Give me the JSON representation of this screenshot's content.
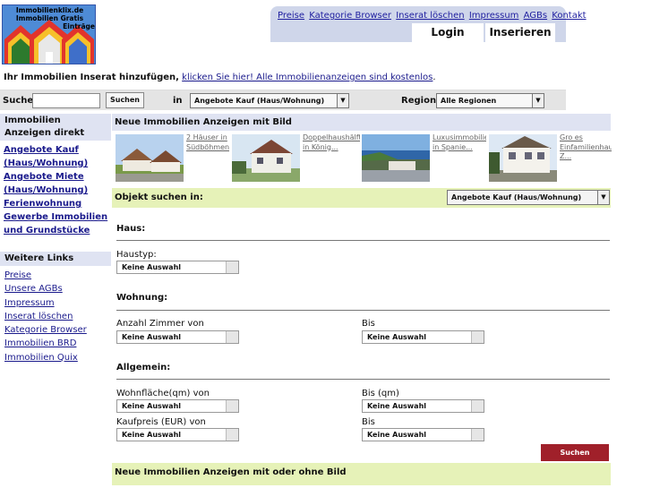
{
  "logo": {
    "line1": "Immobilienklix.de",
    "line2": "Immobilien Gratis",
    "line3": "Einträge"
  },
  "topnav": {
    "links": [
      "Preise",
      "Kategorie Browser",
      "Inserat löschen",
      "Impressum",
      "AGBs",
      "Kontakt"
    ],
    "login": "Login",
    "inserieren": "Inserieren"
  },
  "notice": {
    "bold": "Ihr Immobilien Inserat hinzufügen,",
    "link": "klicken Sie hier! Alle Immobilienanzeigen sind kostenlos",
    "end": "."
  },
  "searchbar": {
    "suche_label": "Suche",
    "search_value": "",
    "search_button": "Suchen",
    "in_label": "in",
    "category_value": "Angebote Kauf (Haus/Wohnung)",
    "region_label": "Region",
    "region_value": "Alle Regionen"
  },
  "sidebar": {
    "head1": "Immobilien Anzeigen direkt",
    "links1": [
      "Angebote Kauf (Haus/Wohnung)",
      "Angebote Miete (Haus/Wohnung)",
      "Ferienwohnung",
      "Gewerbe Immobilien und Grundstücke"
    ],
    "head2": "Weitere Links",
    "links2": [
      "Preise",
      "Unsere AGBs",
      "Impressum",
      "Inserat löschen",
      "Kategorie Browser",
      "Immobilien BRD",
      "Immobilien Quix"
    ]
  },
  "main": {
    "neu_mit_bild": "Neue Immobilien Anzeigen mit Bild",
    "listings": [
      "2 Häuser in Südböhmen...",
      "Doppelhaushälfte in König...",
      "Luxusimmobilien in Spanie...",
      "Gro es Einfamilienhaus Z..."
    ],
    "objekt_label": "Objekt suchen in:",
    "objekt_value": "Angebote Kauf (Haus/Wohnung)",
    "haus": "Haus:",
    "haustyp": "Haustyp:",
    "wohnung": "Wohnung:",
    "zimmer_von": "Anzahl Zimmer von",
    "bis": "Bis",
    "allgemein": "Allgemein:",
    "wohnflaeche_von": "Wohnfläche(qm) von",
    "bis_qm": "Bis (qm)",
    "kaufpreis_von": "Kaufpreis (EUR) von",
    "keine": "Keine Auswahl",
    "suchen": "Suchen",
    "neu_ohne_bild": "Neue Immobilien Anzeigen mit oder ohne Bild"
  },
  "colors": {
    "nav_bg": "#cfd6ea",
    "filter_bg": "#e6f2b8",
    "button_red": "#a0202a",
    "link": "#1a1a8c"
  }
}
